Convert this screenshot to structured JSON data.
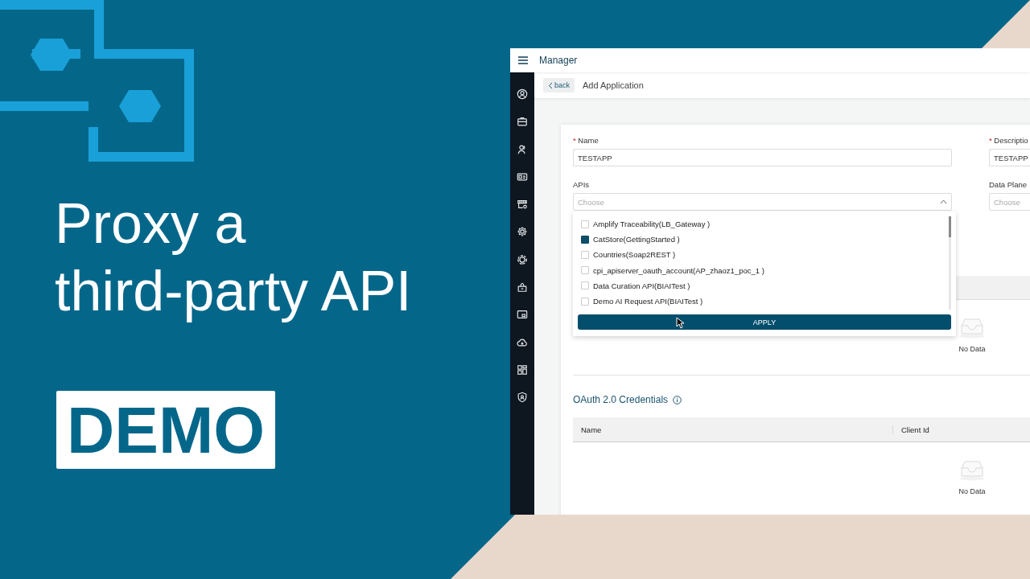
{
  "title": {
    "lines": [
      "Proxy a",
      "third-party API"
    ]
  },
  "badge": "DEMO",
  "app": {
    "header_title": "Manager",
    "back_button": "back",
    "page_title": "Add Application",
    "fields": [
      {
        "kind": "text",
        "required_mark": "*",
        "label": "Name",
        "value": "TESTAPP"
      },
      {
        "kind": "text",
        "required_mark": "*",
        "label": "Descriptio",
        "value": "TESTAPP"
      },
      {
        "kind": "select",
        "label": "APIs",
        "placeholder": "Choose",
        "expanded": true
      },
      {
        "kind": "select",
        "label": "Data Plane",
        "placeholder": "Choose"
      }
    ],
    "dropdown": {
      "options": [
        {
          "label": "Amplify Traceability(LB_Gateway )",
          "checked": false
        },
        {
          "label": "CatStore(GettingStarted )",
          "checked": true
        },
        {
          "label": "Countries(Soap2REST )",
          "checked": false
        },
        {
          "label": "cpi_apiserver_oauth_account(AP_zhaoz1_poc_1 )",
          "checked": false
        },
        {
          "label": "Data Curation API(BIAITest )",
          "checked": false
        },
        {
          "label": "Demo AI Request API(BIAITest )",
          "checked": false
        }
      ],
      "apply": "APPLY"
    },
    "apis_table": {
      "empty": "No Data"
    },
    "credentials": {
      "title": "OAuth 2.0 Credentials",
      "columns": [
        "Name",
        "Client Id"
      ],
      "empty": "No Data"
    }
  }
}
